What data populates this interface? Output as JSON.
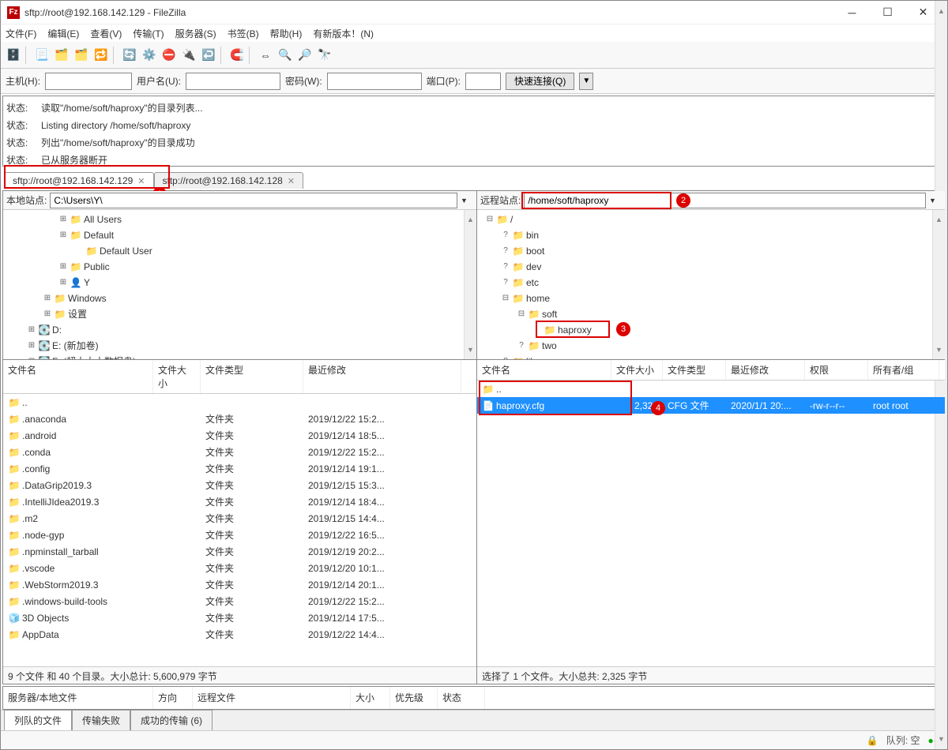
{
  "title": "sftp://root@192.168.142.129 - FileZilla",
  "menu": [
    "文件(F)",
    "编辑(E)",
    "查看(V)",
    "传输(T)",
    "服务器(S)",
    "书签(B)",
    "帮助(H)",
    "有新版本！(N)"
  ],
  "quick": {
    "host_label": "主机(H):",
    "host": "",
    "user_label": "用户名(U):",
    "user": "",
    "pass_label": "密码(W):",
    "pass": "",
    "port_label": "端口(P):",
    "port": "",
    "connect": "快速连接(Q)",
    "arrow": "▼"
  },
  "log": [
    {
      "k": "状态:",
      "v": "读取\"/home/soft/haproxy\"的目录列表..."
    },
    {
      "k": "状态:",
      "v": "Listing directory /home/soft/haproxy"
    },
    {
      "k": "状态:",
      "v": "列出\"/home/soft/haproxy\"的目录成功"
    },
    {
      "k": "状态:",
      "v": "已从服务器断开"
    }
  ],
  "tabs": [
    {
      "label": "sftp://root@192.168.142.129",
      "active": true
    },
    {
      "label": "sftp://root@192.168.142.128",
      "active": false
    }
  ],
  "local": {
    "site_label": "本地站点:",
    "path": "C:\\Users\\Y\\",
    "tree": [
      {
        "pad": 70,
        "exp": "⊞",
        "ico": "📁",
        "name": "All Users"
      },
      {
        "pad": 70,
        "exp": "⊞",
        "ico": "📁",
        "name": "Default"
      },
      {
        "pad": 90,
        "exp": "",
        "ico": "📁",
        "name": "Default User"
      },
      {
        "pad": 70,
        "exp": "⊞",
        "ico": "📁",
        "name": "Public"
      },
      {
        "pad": 70,
        "exp": "⊞",
        "ico": "👤",
        "name": "Y"
      },
      {
        "pad": 50,
        "exp": "⊞",
        "ico": "📁",
        "name": "Windows"
      },
      {
        "pad": 50,
        "exp": "⊞",
        "ico": "📁",
        "name": "设置"
      },
      {
        "pad": 30,
        "exp": "⊞",
        "ico": "💽",
        "name": "D:"
      },
      {
        "pad": 30,
        "exp": "⊞",
        "ico": "💽",
        "name": "E: (新加卷)"
      },
      {
        "pad": 30,
        "exp": "⊞",
        "ico": "💽",
        "name": "F: (超大大大数据盘)"
      }
    ],
    "cols": [
      "文件名",
      "文件大小",
      "文件类型",
      "最近修改"
    ],
    "rows": [
      {
        "n": "..",
        "s": "",
        "t": "",
        "m": "",
        "ico": "📁"
      },
      {
        "n": ".anaconda",
        "s": "",
        "t": "文件夹",
        "m": "2019/12/22 15:2...",
        "ico": "📁"
      },
      {
        "n": ".android",
        "s": "",
        "t": "文件夹",
        "m": "2019/12/14 18:5...",
        "ico": "📁"
      },
      {
        "n": ".conda",
        "s": "",
        "t": "文件夹",
        "m": "2019/12/22 15:2...",
        "ico": "📁"
      },
      {
        "n": ".config",
        "s": "",
        "t": "文件夹",
        "m": "2019/12/14 19:1...",
        "ico": "📁"
      },
      {
        "n": ".DataGrip2019.3",
        "s": "",
        "t": "文件夹",
        "m": "2019/12/15 15:3...",
        "ico": "📁"
      },
      {
        "n": ".IntelliJIdea2019.3",
        "s": "",
        "t": "文件夹",
        "m": "2019/12/14 18:4...",
        "ico": "📁"
      },
      {
        "n": ".m2",
        "s": "",
        "t": "文件夹",
        "m": "2019/12/15 14:4...",
        "ico": "📁"
      },
      {
        "n": ".node-gyp",
        "s": "",
        "t": "文件夹",
        "m": "2019/12/22 16:5...",
        "ico": "📁"
      },
      {
        "n": ".npminstall_tarball",
        "s": "",
        "t": "文件夹",
        "m": "2019/12/19 20:2...",
        "ico": "📁"
      },
      {
        "n": ".vscode",
        "s": "",
        "t": "文件夹",
        "m": "2019/12/20 10:1...",
        "ico": "📁"
      },
      {
        "n": ".WebStorm2019.3",
        "s": "",
        "t": "文件夹",
        "m": "2019/12/14 20:1...",
        "ico": "📁"
      },
      {
        "n": ".windows-build-tools",
        "s": "",
        "t": "文件夹",
        "m": "2019/12/22 15:2...",
        "ico": "📁"
      },
      {
        "n": "3D Objects",
        "s": "",
        "t": "文件夹",
        "m": "2019/12/14 17:5...",
        "ico": "🧊"
      },
      {
        "n": "AppData",
        "s": "",
        "t": "文件夹",
        "m": "2019/12/22 14:4...",
        "ico": "📁"
      }
    ],
    "status": "9 个文件 和 40 个目录。大小总计: 5,600,979 字节"
  },
  "remote": {
    "site_label": "远程站点:",
    "path": "/home/soft/haproxy",
    "tree": [
      {
        "pad": 10,
        "exp": "⊟",
        "ico": "📁",
        "name": "/"
      },
      {
        "pad": 30,
        "exp": "?",
        "ico": "📁",
        "name": "bin"
      },
      {
        "pad": 30,
        "exp": "?",
        "ico": "📁",
        "name": "boot"
      },
      {
        "pad": 30,
        "exp": "?",
        "ico": "📁",
        "name": "dev"
      },
      {
        "pad": 30,
        "exp": "?",
        "ico": "📁",
        "name": "etc"
      },
      {
        "pad": 30,
        "exp": "⊟",
        "ico": "📁",
        "name": "home"
      },
      {
        "pad": 50,
        "exp": "⊟",
        "ico": "📁",
        "name": "soft"
      },
      {
        "pad": 70,
        "exp": "",
        "ico": "📁",
        "name": "haproxy"
      },
      {
        "pad": 50,
        "exp": "?",
        "ico": "📁",
        "name": "two"
      },
      {
        "pad": 30,
        "exp": "?",
        "ico": "📁",
        "name": "lib"
      }
    ],
    "cols": [
      "文件名",
      "文件大小",
      "文件类型",
      "最近修改",
      "权限",
      "所有者/组"
    ],
    "rows": [
      {
        "n": "..",
        "s": "",
        "t": "",
        "m": "",
        "p": "",
        "o": "",
        "ico": "📁",
        "sel": false
      },
      {
        "n": "haproxy.cfg",
        "s": "2,325",
        "t": "CFG 文件",
        "m": "2020/1/1 20:...",
        "p": "-rw-r--r--",
        "o": "root root",
        "ico": "📄",
        "sel": true
      }
    ],
    "status": "选择了 1 个文件。大小总共: 2,325 字节"
  },
  "queue_cols": [
    "服务器/本地文件",
    "方向",
    "远程文件",
    "大小",
    "优先级",
    "状态"
  ],
  "queue_tabs": [
    "列队的文件",
    "传输失败",
    "成功的传输 (6)"
  ],
  "statusbar": {
    "queue": "队列: 空"
  },
  "badges": {
    "b1": "1",
    "b2": "2",
    "b3": "3",
    "b4": "4"
  }
}
